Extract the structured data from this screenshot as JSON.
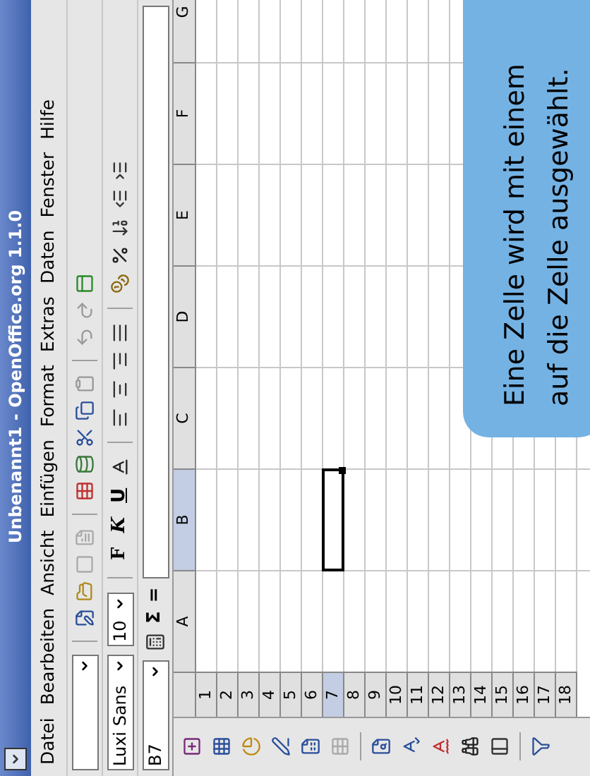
{
  "window": {
    "title": "Unbenannt1 - OpenOffice.org 1.1.0"
  },
  "menu": [
    "Datei",
    "Bearbeiten",
    "Ansicht",
    "Einfügen",
    "Format",
    "Extras",
    "Daten",
    "Fenster",
    "Hilfe"
  ],
  "object_bar": {
    "font": "Luxi Sans",
    "size": "10",
    "bold": "F",
    "italic": "K",
    "underline": "U"
  },
  "formula_bar": {
    "cell": "B7",
    "sum": "Σ",
    "equals": "="
  },
  "sheet": {
    "columns": [
      {
        "label": "A",
        "selected": false
      },
      {
        "label": "B",
        "selected": true
      },
      {
        "label": "C",
        "selected": false
      },
      {
        "label": "D",
        "selected": false
      },
      {
        "label": "E",
        "selected": false
      },
      {
        "label": "F",
        "selected": false
      },
      {
        "label": "G",
        "selected": false
      }
    ],
    "rows": [
      {
        "label": "1",
        "selected": false
      },
      {
        "label": "2",
        "selected": false
      },
      {
        "label": "3",
        "selected": false
      },
      {
        "label": "4",
        "selected": false
      },
      {
        "label": "5",
        "selected": false
      },
      {
        "label": "6",
        "selected": false
      },
      {
        "label": "7",
        "selected": true
      },
      {
        "label": "8",
        "selected": false
      },
      {
        "label": "9",
        "selected": false
      },
      {
        "label": "10",
        "selected": false
      },
      {
        "label": "11",
        "selected": false
      },
      {
        "label": "12",
        "selected": false
      },
      {
        "label": "13",
        "selected": false
      },
      {
        "label": "14",
        "selected": false
      },
      {
        "label": "15",
        "selected": false
      },
      {
        "label": "16",
        "selected": false
      },
      {
        "label": "17",
        "selected": false
      },
      {
        "label": "18",
        "selected": false
      }
    ]
  },
  "callout": {
    "lines": [
      "Eine Zelle wird mit einem",
      "auf die Zelle ausgewählt."
    ]
  }
}
